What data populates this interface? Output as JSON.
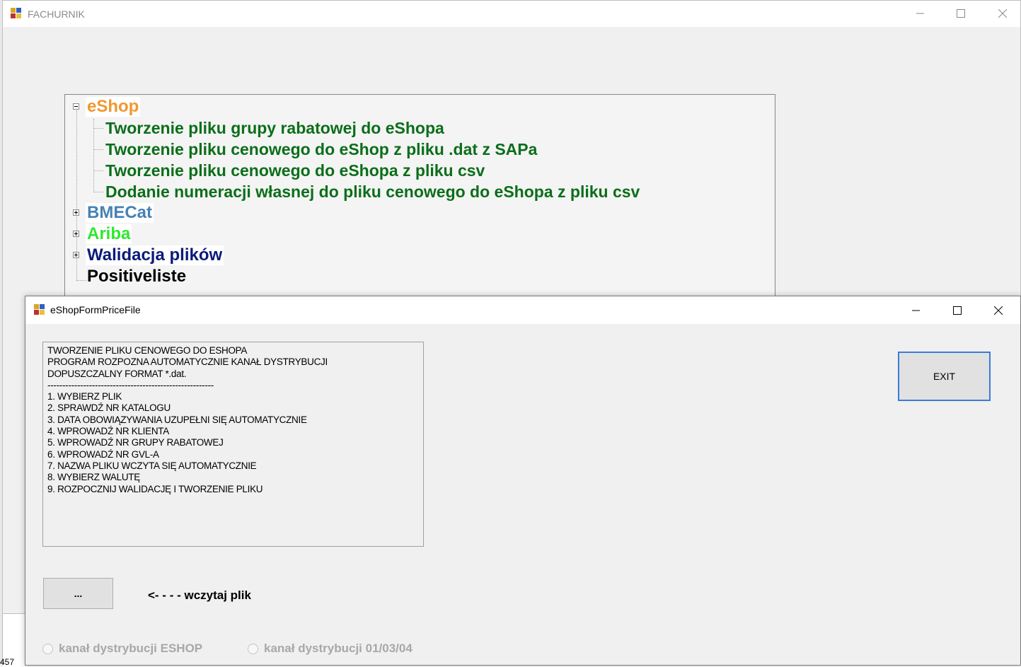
{
  "main_window": {
    "title": "FACHURNIK"
  },
  "tree": {
    "nodes": [
      {
        "label": "eShop",
        "color": "#f0982e",
        "expanded": true
      },
      {
        "label": "Tworzenie pliku grupy rabatowej do eShopa",
        "color": "#0c6e1a"
      },
      {
        "label": "Tworzenie pliku cenowego do eShop z pliku .dat z SAPa",
        "color": "#0c6e1a"
      },
      {
        "label": "Tworzenie pliku cenowego do eShopa z pliku csv",
        "color": "#0c6e1a"
      },
      {
        "label": "Dodanie numeracji własnej do pliku cenowego do eShopa z pliku csv",
        "color": "#0c6e1a"
      },
      {
        "label": "BMECat",
        "color": "#4682b4",
        "expanded": false
      },
      {
        "label": "Ariba",
        "color": "#2ee82e",
        "expanded": false
      },
      {
        "label": "Walidacja plików",
        "color": "#0a1a7a",
        "expanded": false
      },
      {
        "label": "Positiveliste",
        "color": "#000000"
      }
    ]
  },
  "dialog": {
    "title": "eShopFormPriceFile",
    "info_lines": [
      "TWORZENIE PLIKU CENOWEGO DO ESHOPA",
      "PROGRAM ROZPOZNA AUTOMATYCZNIE KANAŁ DYSTRYBUCJI",
      "DOPUSZCZALNY FORMAT *.dat.",
      "--------------------------------------------------------",
      "1. WYBIERZ PLIK",
      "2. SPRAWDŹ NR KATALOGU",
      "3. DATA OBOWIĄZYWANIA UZUPEŁNI SIĘ AUTOMATYCZNIE",
      "4. WPROWADŹ NR KLIENTA",
      "5. WPROWADŹ NR GRUPY RABATOWEJ",
      "6. WPROWADŹ NR GVL-A",
      "7. NAZWA PLIKU WCZYTA SIĘ AUTOMATYCZNIE",
      "8. WYBIERZ WALUTĘ",
      "9. ROZPOCZNIJ WALIDACJĘ I TWORZENIE PLIKU"
    ],
    "exit_label": "EXIT",
    "browse_label": "...",
    "load_hint": "<- - - - wczytaj plik",
    "radio_eshop": "kanał dystrybucji ESHOP",
    "radio_other": "kanał dystrybucji 01/03/04"
  },
  "status_fragment": "457"
}
